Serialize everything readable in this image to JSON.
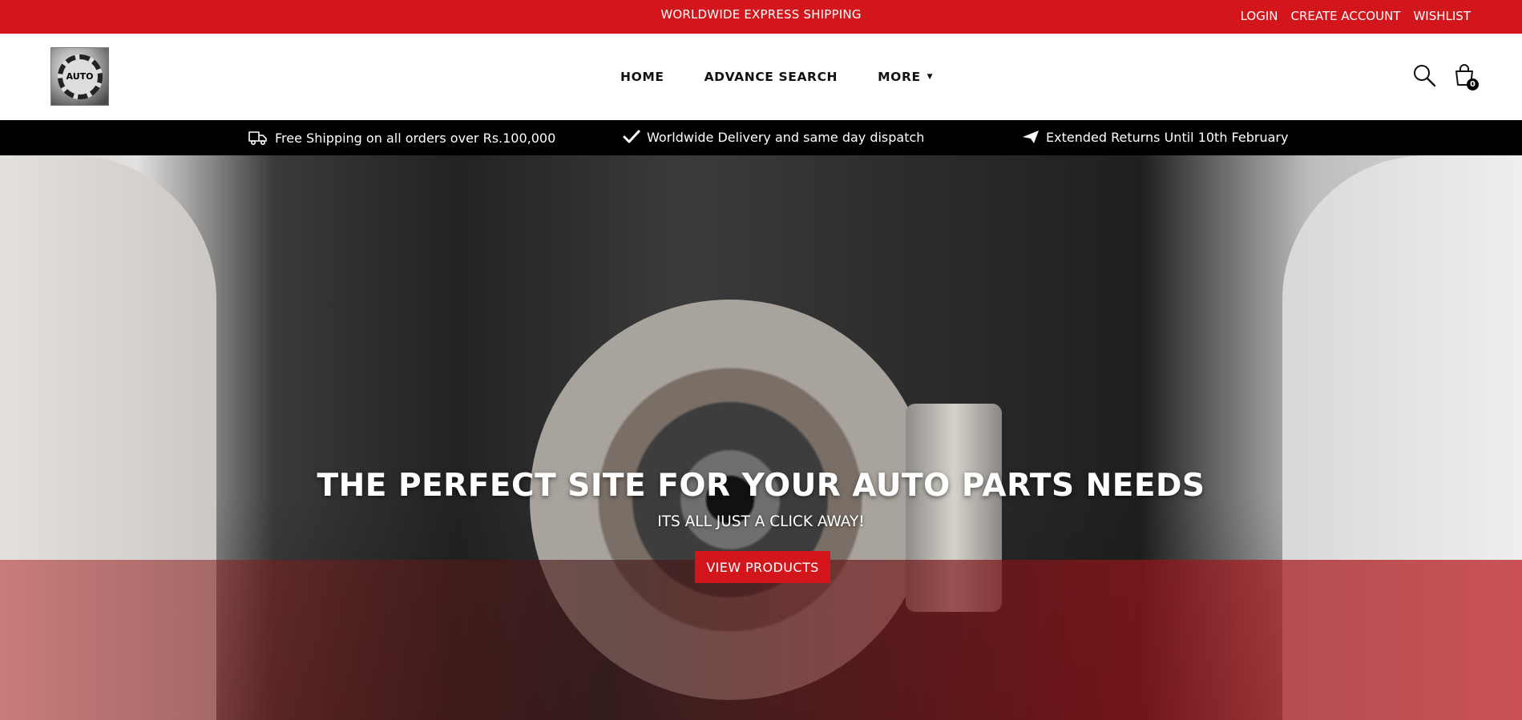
{
  "topbar": {
    "promo": "WORLDWIDE EXPRESS SHIPPING",
    "links": {
      "login": "LOGIN",
      "create_account": "CREATE ACCOUNT",
      "wishlist": "WISHLIST"
    },
    "background": "#d3161b"
  },
  "header": {
    "logo_text": "AUTO",
    "nav": {
      "home": "HOME",
      "advance_search": "ADVANCE SEARCH",
      "more": "MORE"
    },
    "icons": {
      "search": "search-icon",
      "cart": "cart-icon"
    },
    "cart_count": "0"
  },
  "usp": {
    "shipping": "Free Shipping on all orders over Rs.100,000",
    "delivery": "Worldwide Delivery and same day dispatch",
    "returns": "Extended Returns Until 10th February",
    "icons": [
      "truck-icon",
      "checkmark-icon",
      "paper-plane-icon"
    ]
  },
  "hero": {
    "title": "THE PERFECT SITE FOR YOUR AUTO PARTS NEEDS",
    "subtitle": "ITS ALL JUST A CLICK AWAY!",
    "button": "VIEW PRODUCTS",
    "accent": "#d3161b"
  }
}
